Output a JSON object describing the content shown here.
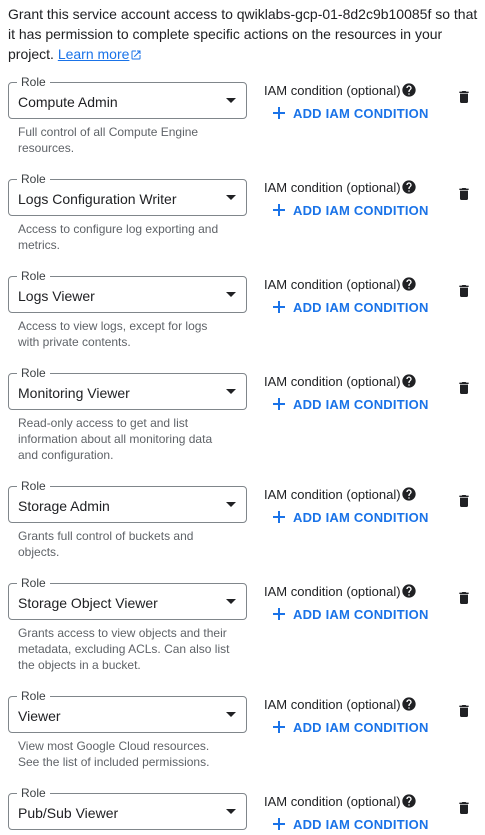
{
  "intro": {
    "text": "Grant this service account access to qwiklabs-gcp-01-8d2c9b10085f so that it has permission to complete specific actions on the resources in your project.",
    "link_text": "Learn more"
  },
  "labels": {
    "role": "Role",
    "iam_condition": "IAM condition (optional)",
    "add_iam_condition": "ADD IAM CONDITION"
  },
  "roles": [
    {
      "name": "Compute Admin",
      "description": "Full control of all Compute Engine resources."
    },
    {
      "name": "Logs Configuration Writer",
      "description": "Access to configure log exporting and metrics."
    },
    {
      "name": "Logs Viewer",
      "description": "Access to view logs, except for logs with private contents."
    },
    {
      "name": "Monitoring Viewer",
      "description": "Read-only access to get and list information about all monitoring data and configuration."
    },
    {
      "name": "Storage Admin",
      "description": "Grants full control of buckets and objects."
    },
    {
      "name": "Storage Object Viewer",
      "description": "Grants access to view objects and their metadata, excluding ACLs. Can also list the objects in a bucket."
    },
    {
      "name": "Viewer",
      "description": "View most Google Cloud resources. See the list of included permissions."
    },
    {
      "name": "Pub/Sub Viewer",
      "description": ""
    }
  ],
  "icons": {
    "help": "help-circle-icon",
    "delete": "trash-icon",
    "add": "plus-icon",
    "external_link": "external-link-icon",
    "dropdown": "chevron-down-icon"
  },
  "colors": {
    "accent": "#1a73e8",
    "text": "#202124",
    "secondary_text": "#5f6368",
    "border": "#80868b"
  }
}
